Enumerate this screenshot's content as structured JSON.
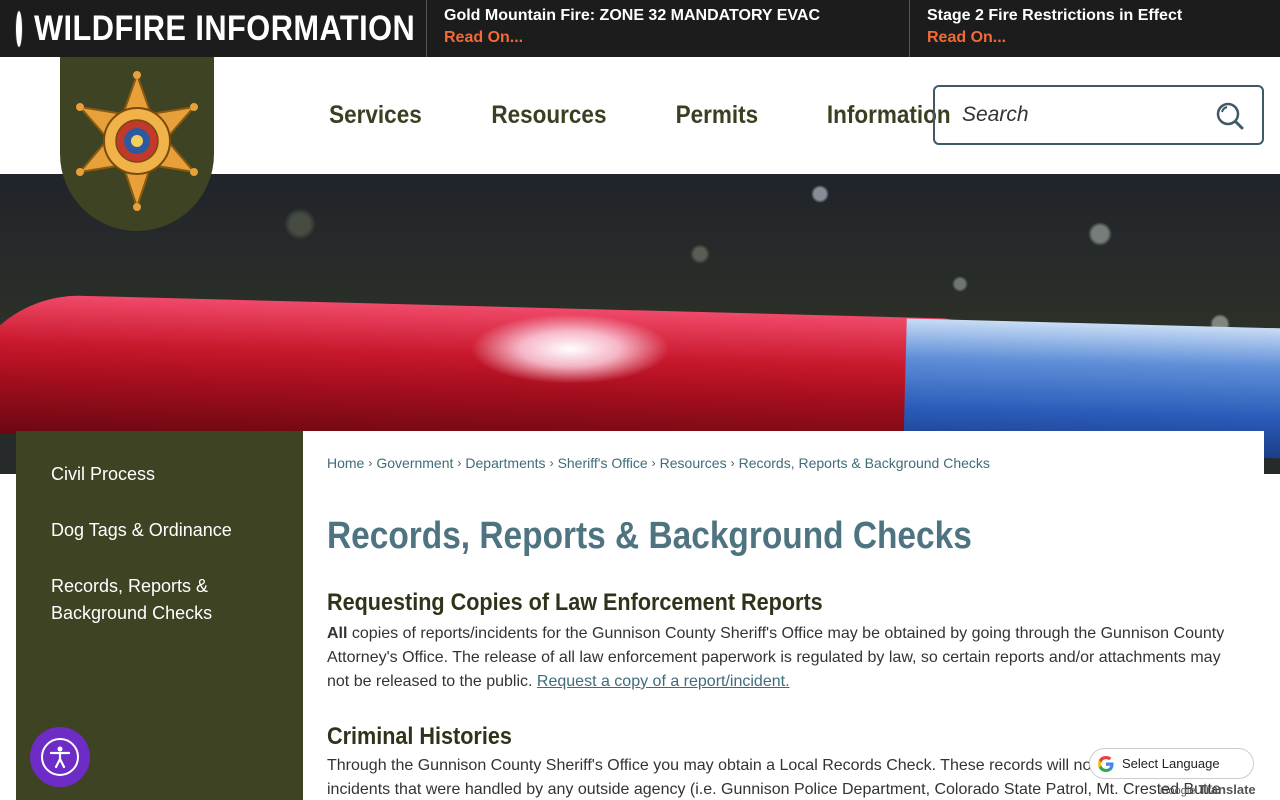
{
  "alerts": {
    "title": "WILDFIRE INFORMATION",
    "items": [
      {
        "headline": "Gold Mountain Fire: ZONE 32 MANDATORY EVAC",
        "link": "Read On..."
      },
      {
        "headline": "Stage 2 Fire Restrictions in Effect",
        "link": "Read On..."
      }
    ]
  },
  "nav": {
    "items": [
      "Services",
      "Resources",
      "Permits",
      "Information"
    ]
  },
  "search": {
    "placeholder": "Search"
  },
  "sidebar": {
    "items": [
      "Civil Process",
      "Dog Tags & Ordinance",
      "Records, Reports & Background Checks"
    ]
  },
  "breadcrumb": [
    "Home",
    "Government",
    "Departments",
    "Sheriff's Office",
    "Resources",
    "Records, Reports & Background Checks"
  ],
  "main": {
    "title": "Records, Reports & Background Checks",
    "sections": [
      {
        "heading": "Requesting Copies of Law Enforcement Reports",
        "lead": "All",
        "text": " copies of reports/incidents for the Gunnison County Sheriff's Office may be obtained by going through the Gunnison County Attorney's Office. The release of all law enforcement paperwork is regulated by law, so certain reports and/or attachments may not be released to the public. ",
        "link": "Request a copy of a report/incident."
      },
      {
        "heading": "Criminal Histories",
        "text": "Through the Gunnison County Sheriff's Office you may obtain a Local Records Check. These records will not include any incidents that were handled by any outside agency (i.e. Gunnison Police Department, Colorado State Patrol, Mt. Crested Butte Police"
      }
    ]
  },
  "translate": {
    "label": "Select Language",
    "powered_by": "Google",
    "brand": "Translate"
  },
  "colors": {
    "olive": "#3e4323",
    "link_teal": "#3e6c7a",
    "alert_orange": "#f26a36",
    "a11y_purple": "#6e2cc6"
  }
}
